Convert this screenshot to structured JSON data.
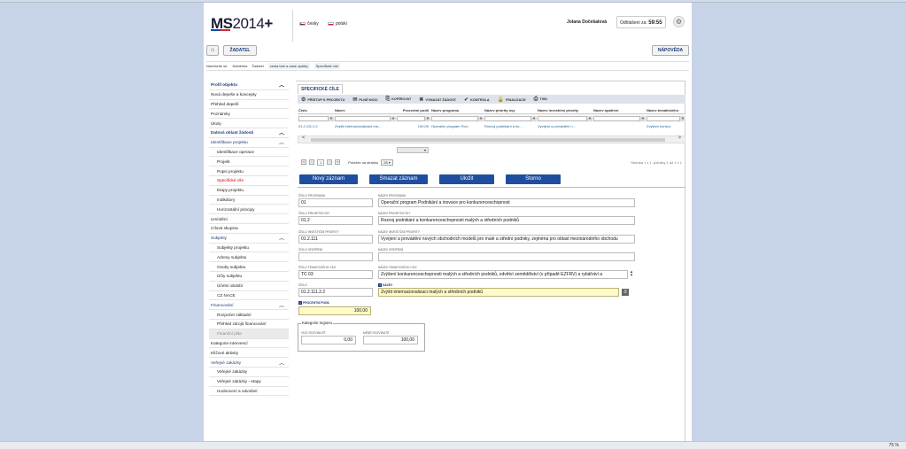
{
  "header": {
    "logo_ms": "MS",
    "logo_year": "2014",
    "logo_plus": "+",
    "lang_cz": "česky",
    "lang_pl": "polski",
    "user_name": "Jolana Dočekalová",
    "logout_label": "Odhlášení za:",
    "logout_time": "59:55",
    "settings_icon": "gear-icon"
  },
  "nav": {
    "home_icon": "home-icon",
    "role_button": "ŽADATEL",
    "help_button": "NÁPOVĚDA"
  },
  "breadcrumb": {
    "prefix": "Nacházíte se:",
    "items": [
      "Nástěnka",
      "Žadatel",
      "cesta tam a zase zpátky",
      "Specifické cíle"
    ]
  },
  "sidebar": {
    "items": [
      {
        "label": "Profil objektu",
        "type": "grp",
        "chev": "︿"
      },
      {
        "label": "Nová depeše a koncepty",
        "type": "plain"
      },
      {
        "label": "Přehled depeší",
        "type": "plain"
      },
      {
        "label": "Poznámky",
        "type": "plain"
      },
      {
        "label": "Úkoly",
        "type": "plain"
      },
      {
        "label": "Datová oblast žádosti",
        "type": "grp",
        "chev": "︿"
      },
      {
        "label": "Identifikace projektu",
        "type": "grp2",
        "chev": "︿"
      },
      {
        "label": "Identifikace operace",
        "type": "sub"
      },
      {
        "label": "Projekt",
        "type": "sub"
      },
      {
        "label": "Popis projektu",
        "type": "sub"
      },
      {
        "label": "Specifické cíle",
        "type": "sub active"
      },
      {
        "label": "Etapy projektu",
        "type": "sub"
      },
      {
        "label": "Indikátory",
        "type": "sub"
      },
      {
        "label": "Horizontální principy",
        "type": "sub"
      },
      {
        "label": "Umístění",
        "type": "plain"
      },
      {
        "label": "Cílová skupina",
        "type": "plain"
      },
      {
        "label": "Subjekty",
        "type": "grp2",
        "chev": "︿"
      },
      {
        "label": "Subjekty projektu",
        "type": "sub"
      },
      {
        "label": "Adresy subjektu",
        "type": "sub"
      },
      {
        "label": "Osoby subjektu",
        "type": "sub"
      },
      {
        "label": "Účty subjektu",
        "type": "sub"
      },
      {
        "label": "Účetní období",
        "type": "sub"
      },
      {
        "label": "CZ NACE",
        "type": "sub"
      },
      {
        "label": "Financování",
        "type": "grp2",
        "chev": "︿"
      },
      {
        "label": "Rozpočet základní",
        "type": "sub"
      },
      {
        "label": "Přehled zdrojů financování",
        "type": "sub"
      },
      {
        "label": "Finanční plán",
        "type": "sub disabled"
      },
      {
        "label": "Kategorie intervencí",
        "type": "plain"
      },
      {
        "label": "Klíčové aktivity",
        "type": "plain"
      },
      {
        "label": "Veřejné zakázky",
        "type": "grp2",
        "chev": "︿"
      },
      {
        "label": "Veřejné zakázky",
        "type": "sub"
      },
      {
        "label": "Veřejné zakázky - etapy",
        "type": "sub"
      },
      {
        "label": "Hodnocení a odvolání",
        "type": "sub"
      }
    ]
  },
  "main": {
    "section_title": "SPECIFICKÉ CÍLE",
    "toolbar": [
      {
        "icon": "⚙",
        "label": "PŘÍSTUP K PROJEKTU",
        "name": "access-button"
      },
      {
        "icon": "✉",
        "label": "PLNÉ MOCI",
        "name": "power-of-attorney-button"
      },
      {
        "icon": "⎘",
        "label": "KOPÍROVAT",
        "name": "copy-button"
      },
      {
        "icon": "✖",
        "label": "VYMAZAT ŽÁDOST",
        "name": "delete-request-button"
      },
      {
        "icon": "✔",
        "label": "KONTROLA",
        "name": "check-button"
      },
      {
        "icon": "🔒",
        "label": "FINALIZACE",
        "name": "finalize-button"
      },
      {
        "icon": "⎙",
        "label": "TISK",
        "name": "print-button"
      }
    ],
    "grid": {
      "columns": [
        "Číslo",
        "Název",
        "Procentní podíl",
        "Název programu",
        "Název priority osy",
        "Název investiční priority",
        "Název opatření",
        "Název tematického"
      ],
      "rows": [
        [
          "01.2.111.2.2",
          "Zvýšit internacionalizaci ma...",
          "100,00",
          "Operační program Pod...",
          "Rozvoj podnikání a ko...",
          "Vyvíjení a provádění n...",
          "",
          "Zvýšení konkur"
        ]
      ]
    },
    "scroll_left": "<",
    "scroll_right": ">",
    "pager": {
      "first": "«",
      "prev": "‹",
      "page": "1",
      "next": "›",
      "last": "»",
      "per_page_label": "Položek na stránku",
      "per_page": "25",
      "info": "Stránka 1 z 1, položky 1 až 1 z 1"
    },
    "actions": {
      "new": "Nový záznam",
      "delete": "Smazat záznam",
      "save": "Uložit",
      "cancel": "Storno"
    },
    "form": {
      "cislo_programu_label": "ČÍSLO PROGRAMU",
      "cislo_programu": "01",
      "nazev_programu_label": "NÁZEV PROGRAMU",
      "nazev_programu": "Operační program Podnikání a inovace pro konkurenceschopnost",
      "cislo_osy_label": "ČÍSLO PRIORITNÍ OSY",
      "cislo_osy": "01.2",
      "nazev_osy_label": "NÁZEV PRIORITNÍ OSY",
      "nazev_osy": "Rozvoj podnikání a konkurenceschopnosti malých a středních podniků",
      "cislo_ip_label": "ČÍSLO INVESTIČNÍ PRIORITY",
      "cislo_ip": "01.2.111",
      "nazev_ip_label": "NÁZEV INVESTIČNÍ PRIORITY",
      "nazev_ip": "Vyvíjení a provádění nových obchodních modelů pro malé a střední podniky, zejména pro oblast mezinárodního obchodu",
      "cislo_opatreni_label": "ČÍSLO OPATŘENÍ",
      "cislo_opatreni": "",
      "nazev_opatreni_label": "NÁZEV OPATŘENÍ",
      "nazev_opatreni": "",
      "cislo_tc_label": "ČÍSLO TEMATICKÉHO CÍLE",
      "cislo_tc": "TC 03",
      "nazev_tc_label": "NÁZEV TEMATICKÉHO CÍLE",
      "nazev_tc": "Zvýšení konkurenceschopnosti malých a středních podniků, odvětví zemědělství (v případě EZFRV) a rybářství a",
      "cislo_label": "ČÍSLO",
      "cislo": "01.2.111.2.2",
      "nazev_label": "NÁZEV",
      "nazev": "Zvýšit internacionalizaci malých a středních podniků",
      "podil_label": "PROCENTNÍ PODÍL",
      "podil": "100,00",
      "kategorie_legend": "Kategorie regionu",
      "vice_label": "VÍCE ROZVINUTÉ",
      "vice": "0,00",
      "mene_label": "MÉNĚ ROZVINUTÉ",
      "mene": "100,00"
    }
  },
  "statusbar": {
    "zoom": "75 %"
  }
}
